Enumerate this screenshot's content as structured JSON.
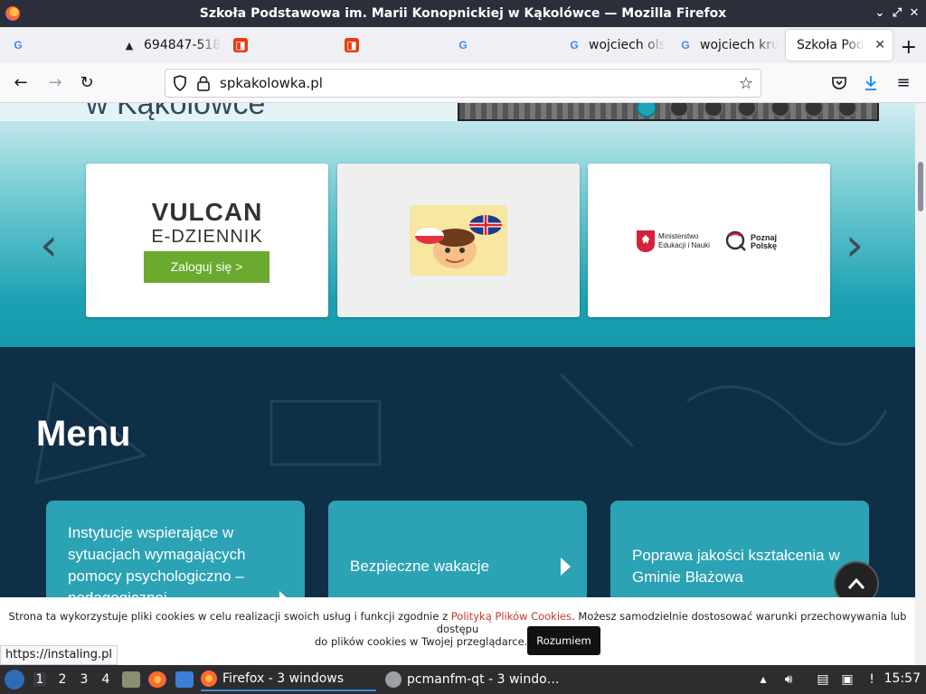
{
  "window": {
    "title": "Szkoła Podstawowa im. Marii Konopnickiej w Kąkolówce — Mozilla Firefox"
  },
  "tabs": [
    {
      "label": "",
      "icon": "google-icon"
    },
    {
      "label": "694847-518",
      "icon": "site-icon"
    },
    {
      "label": "",
      "icon": "site-icon"
    },
    {
      "label": "",
      "icon": "site-icon"
    },
    {
      "label": "",
      "icon": "google-icon"
    },
    {
      "label": "wojciech ols",
      "icon": "google-icon"
    },
    {
      "label": "wojciech kru",
      "icon": "google-icon"
    },
    {
      "label": "Szkoła Pod",
      "icon": "none",
      "active": true
    }
  ],
  "navbar": {
    "url": "spkakolowka.pl"
  },
  "page": {
    "hero_heading": "w Kąkolówce",
    "slider_dots": 7,
    "active_dot": 0,
    "cards": {
      "vulcan_title": "VULCAN",
      "vulcan_sub": "E-DZIENNIK",
      "login_label": "Zaloguj się >",
      "ministry_label": "Ministerstwo Edukacji i Nauki",
      "poznaj_label": "Poznaj Polskę"
    },
    "menu_heading": "Menu",
    "menu_tiles": [
      "Instytucje wspierające w sytuacjach wymagających pomocy psychologiczno – pedagogicznej",
      "Bezpieczne wakacje",
      "Poprawa jakości kształcenia w Gminie Błażowa"
    ],
    "cookie": {
      "text_before": "Strona ta wykorzystuje pliki cookies w celu realizacji swoich usług i funkcji zgodnie z ",
      "link": "Polityką Plików Cookies",
      "text_after": ". Możesz samodzielnie dostosować warunki przechowywania lub dostępu",
      "line2": "do plików cookies w Twojej przeglądarce.",
      "accept": "Rozumiem"
    },
    "status_url": "https://instaling.pl"
  },
  "taskbar": {
    "workspaces": [
      "1",
      "2",
      "3",
      "4"
    ],
    "tasks": [
      {
        "label": "Firefox - 3 windows",
        "active": true
      },
      {
        "label": "pcmanfm-qt - 3 windo…",
        "active": false
      }
    ],
    "clock": "15:57"
  },
  "colors": {
    "accent_teal": "#2ba3b4",
    "dark_bg": "#0f2f47",
    "vulcan_green": "#6aaa2e",
    "cookie_link": "#c0392b"
  }
}
